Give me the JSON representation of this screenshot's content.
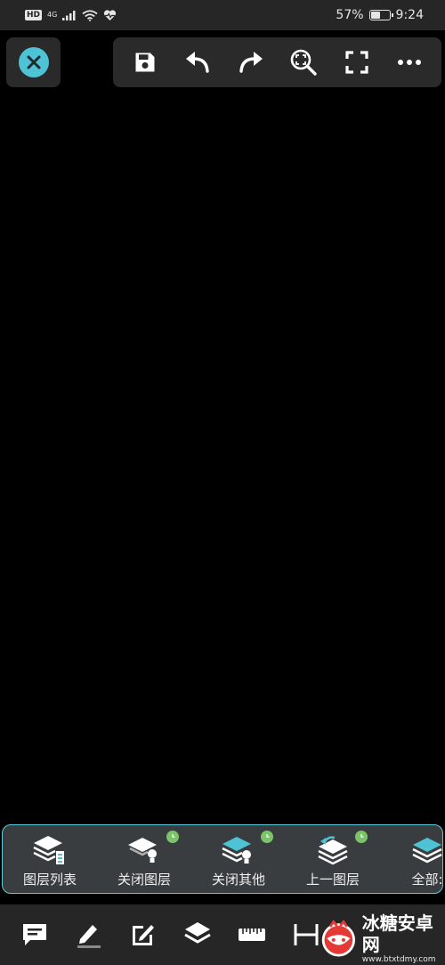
{
  "status_bar": {
    "hd": "HD",
    "network": "4G",
    "battery_percent": "57%",
    "battery_level": 0.57,
    "time": "9:24"
  },
  "top_toolbar": {
    "icons": [
      "close-icon",
      "save-icon",
      "undo-icon",
      "redo-icon",
      "zoom-fit-icon",
      "fullscreen-icon",
      "more-icon"
    ]
  },
  "layer_panel": {
    "items": [
      {
        "label": "图层列表",
        "icon": "layers-list-icon",
        "badge": false
      },
      {
        "label": "关闭图层",
        "icon": "layer-off-icon",
        "badge": true
      },
      {
        "label": "关闭其他",
        "icon": "layers-others-off-icon",
        "badge": true
      },
      {
        "label": "上一图层",
        "icon": "previous-layer-icon",
        "badge": true
      },
      {
        "label": "全部:",
        "icon": "all-layers-icon",
        "badge": false
      }
    ]
  },
  "bottom_toolbar": {
    "icons": [
      "comment-icon",
      "pencil-icon",
      "edit-note-icon",
      "layers-icon",
      "ruler-icon",
      "dimension-icon"
    ]
  },
  "watermark": {
    "title": "冰糖安卓网",
    "url": "www.btxtdmy.com"
  },
  "colors": {
    "accent": "#4fc3d6",
    "badge": "#7cc36a",
    "panel": "#3a3d3f",
    "toolbar": "#2a2a2a"
  }
}
